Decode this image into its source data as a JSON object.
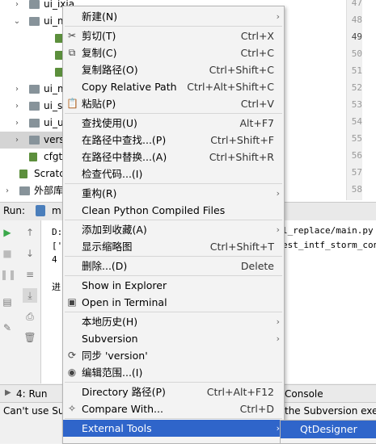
{
  "tree": {
    "rows": [
      {
        "label": "ui_ixia",
        "arrow": "›",
        "indent": 1,
        "folder": true
      },
      {
        "label": "ui_m",
        "arrow": "⌄",
        "indent": 1,
        "folder": true
      },
      {
        "label": "",
        "arrow": "",
        "indent": 2,
        "folder": false
      },
      {
        "label": "",
        "arrow": "",
        "indent": 2,
        "folder": false
      },
      {
        "label": "",
        "arrow": "",
        "indent": 2,
        "folder": false
      },
      {
        "label": "ui_m",
        "arrow": "›",
        "indent": 1,
        "folder": true
      },
      {
        "label": "ui_s",
        "arrow": "›",
        "indent": 1,
        "folder": true
      },
      {
        "label": "ui_u",
        "arrow": "›",
        "indent": 1,
        "folder": true
      },
      {
        "label": "vers",
        "arrow": "›",
        "indent": 1,
        "folder": true,
        "selected": true
      },
      {
        "label": "cfgt",
        "arrow": "",
        "indent": 1,
        "folder": false
      },
      {
        "label": "Scratch",
        "arrow": "",
        "indent": 0,
        "folder": false
      },
      {
        "label": "外部库",
        "arrow": "›",
        "indent": 0,
        "folder": true
      }
    ]
  },
  "gutter": {
    "lines": [
      "47",
      "48",
      "49",
      "50",
      "51",
      "52",
      "53",
      "54",
      "55",
      "56",
      "57",
      "58"
    ]
  },
  "run": {
    "label": "Run:",
    "tab": "m",
    "console_lines": [
      "D:",
      "['",
      "4",
      "",
      "进"
    ],
    "console_right": [
      "l_replace/main.py",
      "est_intf_storm_contr"
    ]
  },
  "bottom_tabs": {
    "run_tab": "4: Run",
    "console_tab": "Console"
  },
  "status": {
    "left": "Can't use Sul",
    "right": "the Subversion exe"
  },
  "menu": {
    "items": [
      {
        "label": "新建(N)",
        "shortcut": "",
        "sub": true,
        "icon": ""
      },
      {
        "sep": true
      },
      {
        "label": "剪切(T)",
        "shortcut": "Ctrl+X",
        "icon": "✂"
      },
      {
        "label": "复制(C)",
        "shortcut": "Ctrl+C",
        "icon": "⧉"
      },
      {
        "label": "复制路径(O)",
        "shortcut": "Ctrl+Shift+C",
        "icon": ""
      },
      {
        "label": "Copy Relative Path",
        "shortcut": "Ctrl+Alt+Shift+C",
        "icon": ""
      },
      {
        "label": "粘贴(P)",
        "shortcut": "Ctrl+V",
        "icon": "📋"
      },
      {
        "sep": true
      },
      {
        "label": "查找使用(U)",
        "shortcut": "Alt+F7",
        "icon": ""
      },
      {
        "label": "在路径中查找...(P)",
        "shortcut": "Ctrl+Shift+F",
        "icon": ""
      },
      {
        "label": "在路径中替换...(A)",
        "shortcut": "Ctrl+Shift+R",
        "icon": ""
      },
      {
        "label": "检查代码...(I)",
        "shortcut": "",
        "icon": ""
      },
      {
        "sep": true
      },
      {
        "label": "重构(R)",
        "shortcut": "",
        "sub": true,
        "icon": ""
      },
      {
        "label": "Clean Python Compiled Files",
        "shortcut": "",
        "icon": ""
      },
      {
        "sep": true
      },
      {
        "label": "添加到收藏(A)",
        "shortcut": "",
        "sub": true,
        "icon": ""
      },
      {
        "label": "显示缩略图",
        "shortcut": "Ctrl+Shift+T",
        "icon": ""
      },
      {
        "sep": true
      },
      {
        "label": "删除...(D)",
        "shortcut": "Delete",
        "icon": ""
      },
      {
        "sep": true
      },
      {
        "label": "Show in Explorer",
        "shortcut": "",
        "icon": ""
      },
      {
        "label": "Open in Terminal",
        "shortcut": "",
        "icon": "▣"
      },
      {
        "sep": true
      },
      {
        "label": "本地历史(H)",
        "shortcut": "",
        "sub": true,
        "icon": ""
      },
      {
        "label": "Subversion",
        "shortcut": "",
        "sub": true,
        "icon": ""
      },
      {
        "label": "同步 'version'",
        "shortcut": "",
        "icon": "⟳"
      },
      {
        "label": "编辑范围...(I)",
        "shortcut": "",
        "icon": "◉"
      },
      {
        "sep": true
      },
      {
        "label": "Directory 路径(P)",
        "shortcut": "Ctrl+Alt+F12",
        "icon": ""
      },
      {
        "label": "Compare With...",
        "shortcut": "Ctrl+D",
        "icon": "✧"
      },
      {
        "sep": true
      },
      {
        "label": "External Tools",
        "shortcut": "",
        "sub": true,
        "icon": "",
        "active": true
      }
    ]
  },
  "submenu": {
    "item": "QtDesigner"
  },
  "colors": {
    "menu_highlight": "#2f65ca",
    "selected_row": "#d4d4d4"
  }
}
